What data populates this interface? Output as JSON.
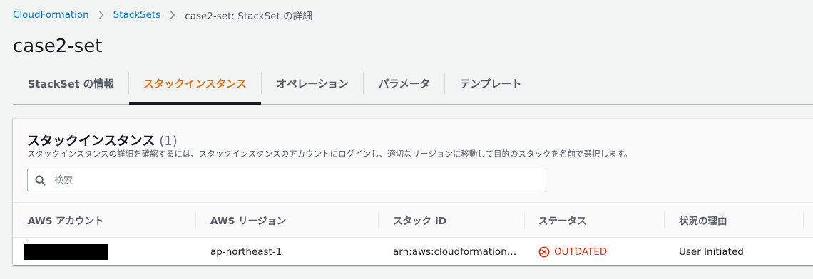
{
  "breadcrumb": {
    "items": [
      {
        "label": "CloudFormation"
      },
      {
        "label": "StackSets"
      },
      {
        "label": "case2-set: StackSet の詳細"
      }
    ]
  },
  "page": {
    "title": "case2-set"
  },
  "tabs": [
    {
      "label": "StackSet の情報",
      "active": false
    },
    {
      "label": "スタックインスタンス",
      "active": true
    },
    {
      "label": "オペレーション",
      "active": false
    },
    {
      "label": "パラメータ",
      "active": false
    },
    {
      "label": "テンプレート",
      "active": false
    }
  ],
  "panel": {
    "title": "スタックインスタンス",
    "count": "(1)",
    "description": "スタックインスタンスの詳細を確認するには、スタックインスタンスのアカウントにログインし、適切なリージョンに移動して目的のスタックを名前で選択します。"
  },
  "search": {
    "placeholder": "検索",
    "value": ""
  },
  "table": {
    "columns": [
      "AWS アカウント",
      "AWS リージョン",
      "スタック ID",
      "ステータス",
      "状況の理由"
    ],
    "rows": [
      {
        "account": "",
        "region": "ap-northeast-1",
        "stack_id": "arn:aws:cloudformation…",
        "status": "OUTDATED",
        "status_icon": "error-circle-icon",
        "reason": "User Initiated"
      }
    ]
  },
  "colors": {
    "link": "#0073bb",
    "active_tab": "#ec7211",
    "error": "#d13212",
    "background": "#f2f3f3"
  }
}
